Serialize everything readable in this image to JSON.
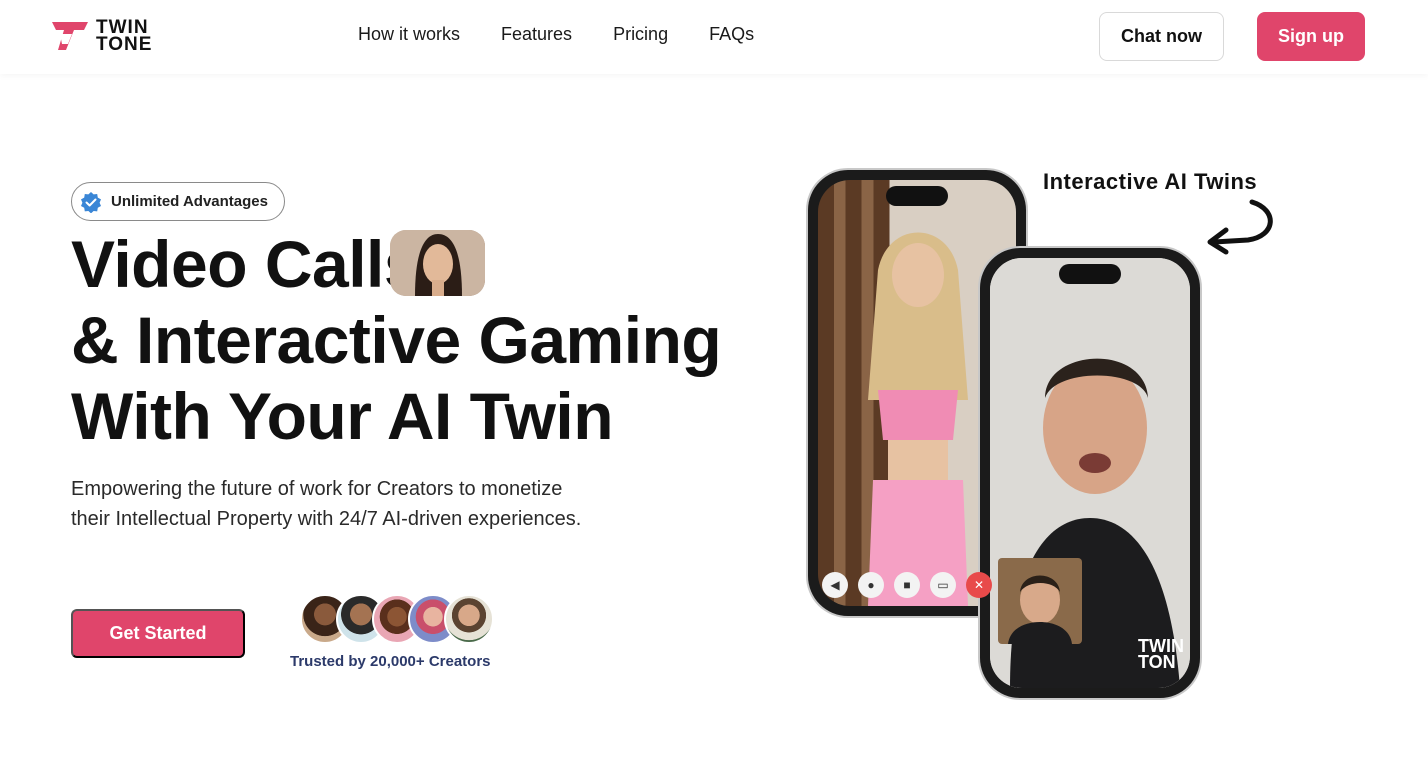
{
  "brand": {
    "line1": "TWIN",
    "line2": "TONE",
    "accent": "#e0456b"
  },
  "nav": [
    "How it works",
    "Features",
    "Pricing",
    "FAQs"
  ],
  "header": {
    "chat_label": "Chat now",
    "signup_label": "Sign up"
  },
  "hero": {
    "badge": "Unlimited Advantages",
    "line1": "Video Calls",
    "line2": "& Interactive Gaming",
    "line3": "With Your AI Twin",
    "subtitle_1": "Empowering the future of work for Creators to  monetize",
    "subtitle_2": "their Intellectual Property with 24/7 AI-driven experiences.",
    "cta_label": "Get Started",
    "trusted": "Trusted by 20,000+ Creators"
  },
  "visual": {
    "caption": "Interactive AI Twins",
    "watermark_1": "TWIN",
    "watermark_2": "TON"
  },
  "icons": [
    "verified-check-icon",
    "speaker-icon",
    "mic-icon",
    "camera-icon",
    "screen-icon",
    "end-call-icon",
    "curved-arrow-icon"
  ]
}
